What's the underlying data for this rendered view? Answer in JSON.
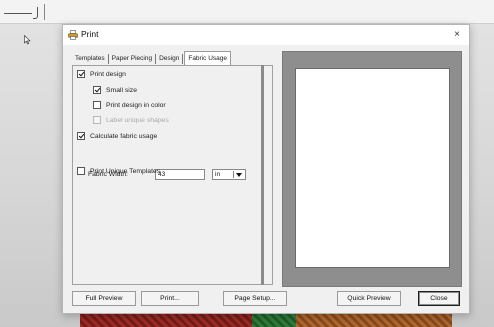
{
  "dialog": {
    "title": "Print",
    "close_glyph": "×"
  },
  "tabs": [
    "Templates",
    "Paper Piecing",
    "Design",
    "Fabric Usage"
  ],
  "active_tab": "Fabric Usage",
  "options": {
    "print_design": {
      "label": "Print design",
      "checked": true
    },
    "small_size": {
      "label": "Small size",
      "checked": true
    },
    "print_design_color": {
      "label": "Print design in color",
      "checked": false
    },
    "label_unique_shapes": {
      "label": "Label unique shapes",
      "checked": false,
      "disabled": true
    },
    "calculate_fabric": {
      "label": "Calculate fabric usage",
      "checked": true
    },
    "print_unique_templates": {
      "label": "Print Unique Templates",
      "checked": false
    }
  },
  "fabric_width": {
    "label": "Fabric Width:",
    "value": "43",
    "unit": "in"
  },
  "buttons": {
    "full_preview": "Full Preview",
    "print": "Print...",
    "page_setup": "Page Setup...",
    "quick_preview": "Quick Preview",
    "close": "Close"
  },
  "icons": {
    "title_icon": "printer-icon",
    "close_icon": "close-icon",
    "dropdown_icon": "chevron-down-icon"
  }
}
